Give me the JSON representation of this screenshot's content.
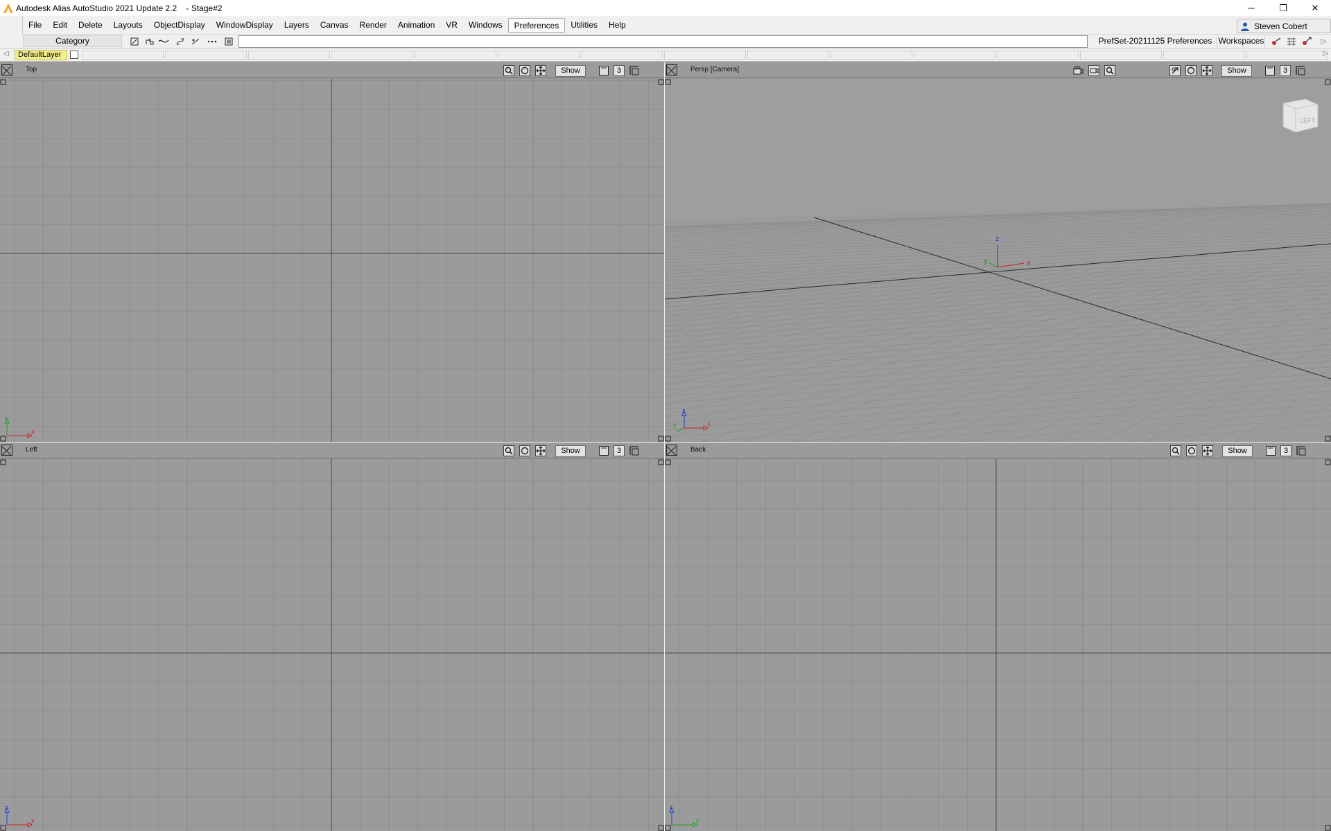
{
  "window": {
    "title": "Autodesk Alias AutoStudio 2021 Update 2.2    - Stage#2",
    "minimize": "─",
    "restore": "❐",
    "close": "✕"
  },
  "menu": {
    "items": [
      "File",
      "Edit",
      "Delete",
      "Layouts",
      "ObjectDisplay",
      "WindowDisplay",
      "Layers",
      "Canvas",
      "Render",
      "Animation",
      "VR",
      "Windows",
      "Preferences",
      "Utilities",
      "Help"
    ],
    "active": "Preferences",
    "user": "Steven Cobert"
  },
  "palette": {
    "category": "Category",
    "prefset": "PrefSet-20211125 Preferences",
    "workspaces": "Workspaces"
  },
  "layers": {
    "default_layer": "DefaultLayer"
  },
  "viewports": {
    "top": {
      "title": "Top",
      "show": "Show",
      "count": "3"
    },
    "persp": {
      "title": "Persp [Camera]",
      "show": "Show",
      "count": "3",
      "viewcube": "LEFT",
      "axis_x": "x",
      "axis_y": "y",
      "axis_z": "z"
    },
    "left": {
      "title": "Left",
      "show": "Show",
      "count": "3"
    },
    "back": {
      "title": "Back",
      "show": "Show",
      "count": "3"
    }
  },
  "axis_labels": {
    "top": [
      "y",
      "x"
    ],
    "persp": [
      "z",
      "y",
      "x"
    ],
    "left": [
      "z",
      "x"
    ],
    "back": [
      "z",
      "y"
    ]
  },
  "colors": {
    "grid": "#8e8e8e",
    "viewport_bg": "#9b9b9b",
    "axis_x": "#d02020",
    "axis_y": "#20a020",
    "axis_z": "#2040d0",
    "layer_highlight": "#f2ef8c"
  }
}
